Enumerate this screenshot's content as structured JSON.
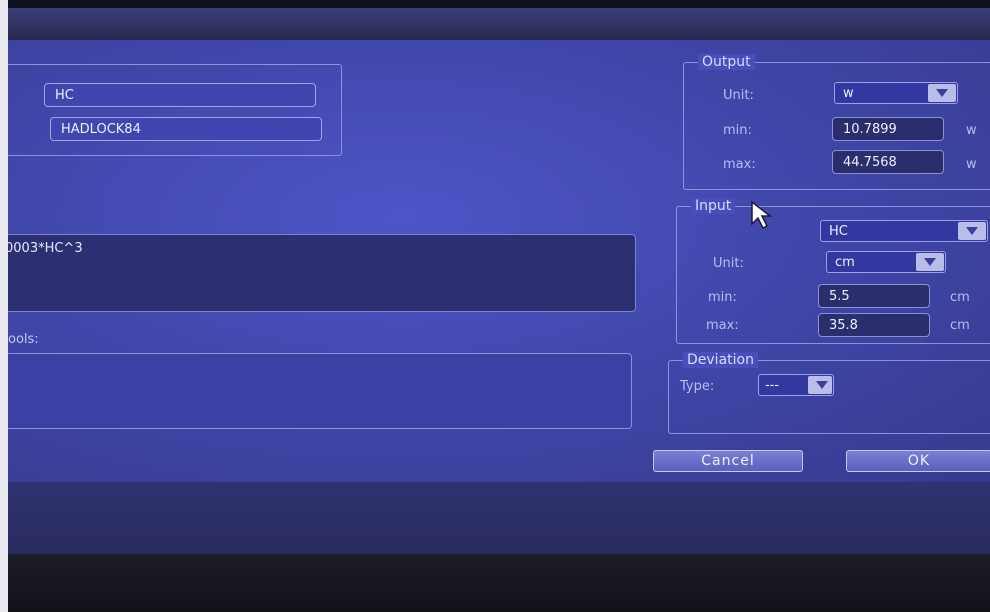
{
  "dialog": {
    "name_value": "HC",
    "author_value": "HADLOCK84",
    "formula_value": "0003*HC^3",
    "tools_label": "ools:",
    "tools_value": ""
  },
  "output": {
    "legend": "Output",
    "unit_label": "Unit:",
    "unit_value": "w",
    "min_label": "min:",
    "min_value": "10.7899",
    "min_unit": "w",
    "max_label": "max:",
    "max_value": "44.7568",
    "max_unit": "w"
  },
  "input": {
    "legend": "Input",
    "param_value": "HC",
    "unit_label": "Unit:",
    "unit_value": "cm",
    "min_label": "min:",
    "min_value": "5.5",
    "min_unit": "cm",
    "max_label": "max:",
    "max_value": "35.8",
    "max_unit": "cm"
  },
  "deviation": {
    "legend": "Deviation",
    "type_label": "Type:",
    "type_value": "---"
  },
  "buttons": {
    "cancel": "Cancel",
    "ok": "OK"
  },
  "colors": {
    "screen": "#4148ac",
    "field_bg": "#3f46b0",
    "button": "#6a70c8"
  },
  "icons": {
    "dropdown": "chevron-down-icon",
    "pointer": "mouse-cursor-icon"
  }
}
